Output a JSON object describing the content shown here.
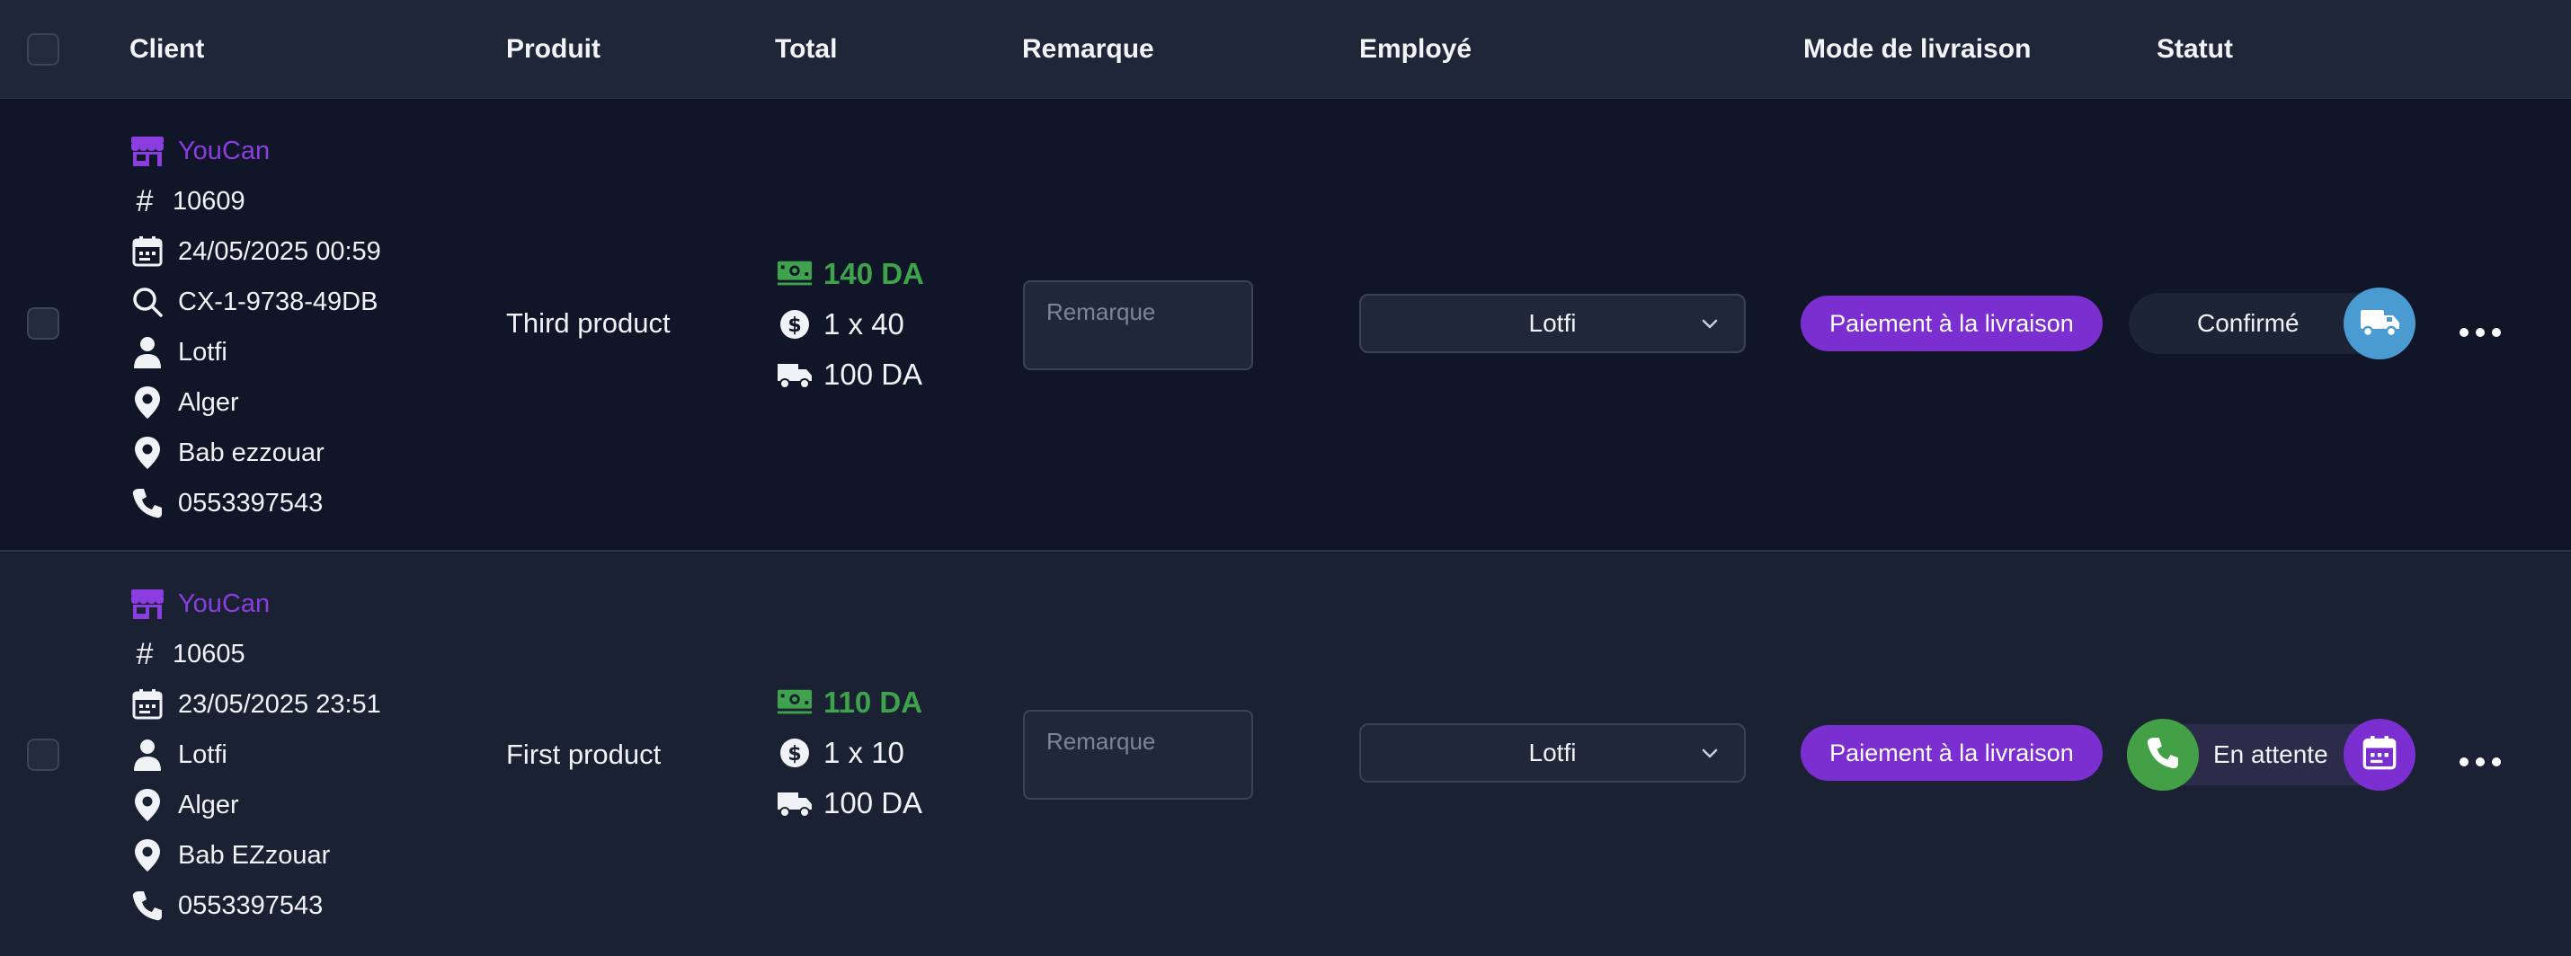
{
  "header": {
    "columns": {
      "client": "Client",
      "product": "Produit",
      "total": "Total",
      "remark": "Remarque",
      "employee": "Employé",
      "delivery_mode": "Mode de livraison",
      "status": "Statut"
    }
  },
  "colors": {
    "accent_purple": "#7b2fd0",
    "store_purple": "#8a3ee0",
    "amount_green": "#3fa34d",
    "confirmed_blue": "#4a9bd1",
    "call_green": "#43a047"
  },
  "orders": [
    {
      "store": "YouCan",
      "id": "10609",
      "date": "24/05/2025 00:59",
      "tracking": "CX-1-9738-49DB",
      "customer": "Lotfi",
      "city": "Alger",
      "address": "Bab ezzouar",
      "phone": "0553397543",
      "product": "Third product",
      "total": "140 DA",
      "quantity_price": "1 x 40",
      "shipping": "100 DA",
      "remark_placeholder": "Remarque",
      "employee": "Lotfi",
      "delivery_mode": "Paiement à la livraison",
      "status": "Confirmé",
      "status_icon": "truck-icon"
    },
    {
      "store": "YouCan",
      "id": "10605",
      "date": "23/05/2025 23:51",
      "customer": "Lotfi",
      "city": "Alger",
      "address": "Bab EZzouar",
      "phone": "0553397543",
      "product": "First product",
      "total": "110 DA",
      "quantity_price": "1 x 10",
      "shipping": "100 DA",
      "remark_placeholder": "Remarque",
      "employee": "Lotfi",
      "delivery_mode": "Paiement à la livraison",
      "status": "En attente",
      "status_icons": [
        "phone-icon",
        "calendar-icon"
      ]
    }
  ]
}
